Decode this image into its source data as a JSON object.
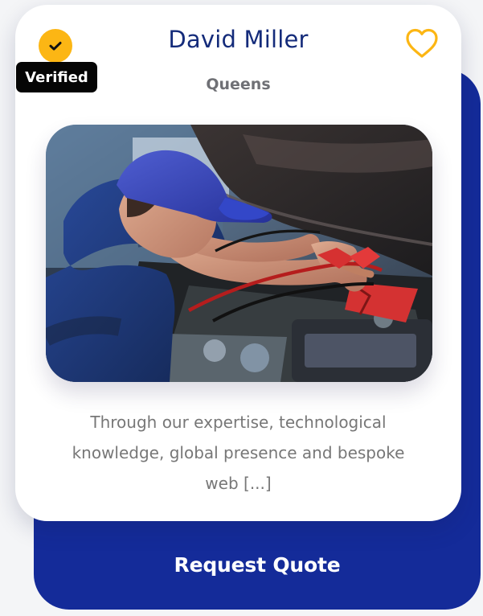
{
  "card": {
    "verified_label": "Verified",
    "name": "David Miller",
    "location": "Queens",
    "description": "Through our expertise, technological knowledge, global presence and bespoke web [...]",
    "cta_label": "Request Quote",
    "photo_alt": "Mechanic working under car hood with jumper cables"
  },
  "icons": {
    "verified": "check-circle-icon",
    "favorite": "heart-outline-icon"
  },
  "colors": {
    "brand_blue": "#142b99",
    "name_blue": "#142b7a",
    "accent_yellow": "#fcb614",
    "badge_black": "#050505",
    "text_gray": "#777777"
  }
}
